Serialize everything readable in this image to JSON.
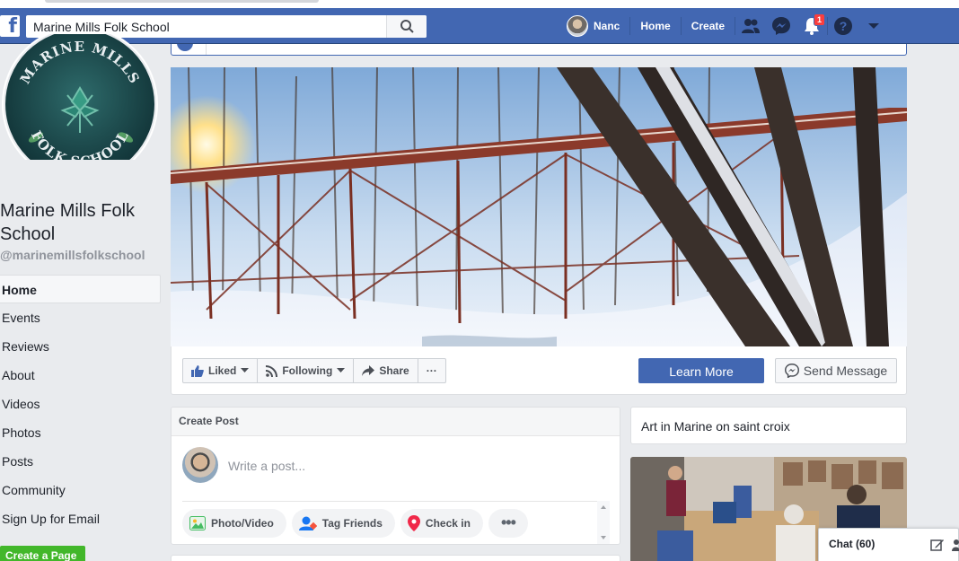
{
  "topbar": {
    "search_value": "Marine Mills Folk School",
    "user_name": "Nanc",
    "home_label": "Home",
    "create_label": "Create",
    "notification_count": "1"
  },
  "page": {
    "logo_text_top": "MARINE MILLS",
    "logo_text_bottom": "FOLK SCHOOL",
    "name": "Marine Mills Folk School",
    "handle": "@marinemillsfolkschool",
    "nav": [
      {
        "label": "Home"
      },
      {
        "label": "Events"
      },
      {
        "label": "Reviews"
      },
      {
        "label": "About"
      },
      {
        "label": "Videos"
      },
      {
        "label": "Photos"
      },
      {
        "label": "Posts"
      },
      {
        "label": "Community"
      },
      {
        "label": "Sign Up for Email"
      }
    ],
    "create_page_label": "Create a Page"
  },
  "actions": {
    "liked": "Liked",
    "following": "Following",
    "share": "Share",
    "more": "···",
    "learn_more": "Learn More",
    "send_message": "Send Message"
  },
  "create_post": {
    "title": "Create Post",
    "placeholder": "Write a post...",
    "photo_video": "Photo/Video",
    "tag_friends": "Tag Friends",
    "check_in": "Check in",
    "more": "•••"
  },
  "right": {
    "title": "Art in Marine on saint croix"
  },
  "chat": {
    "label": "Chat (60)"
  },
  "colors": {
    "brand_blue": "#4267b2",
    "green": "#42b72a",
    "notification_red": "#fa3e3e"
  }
}
